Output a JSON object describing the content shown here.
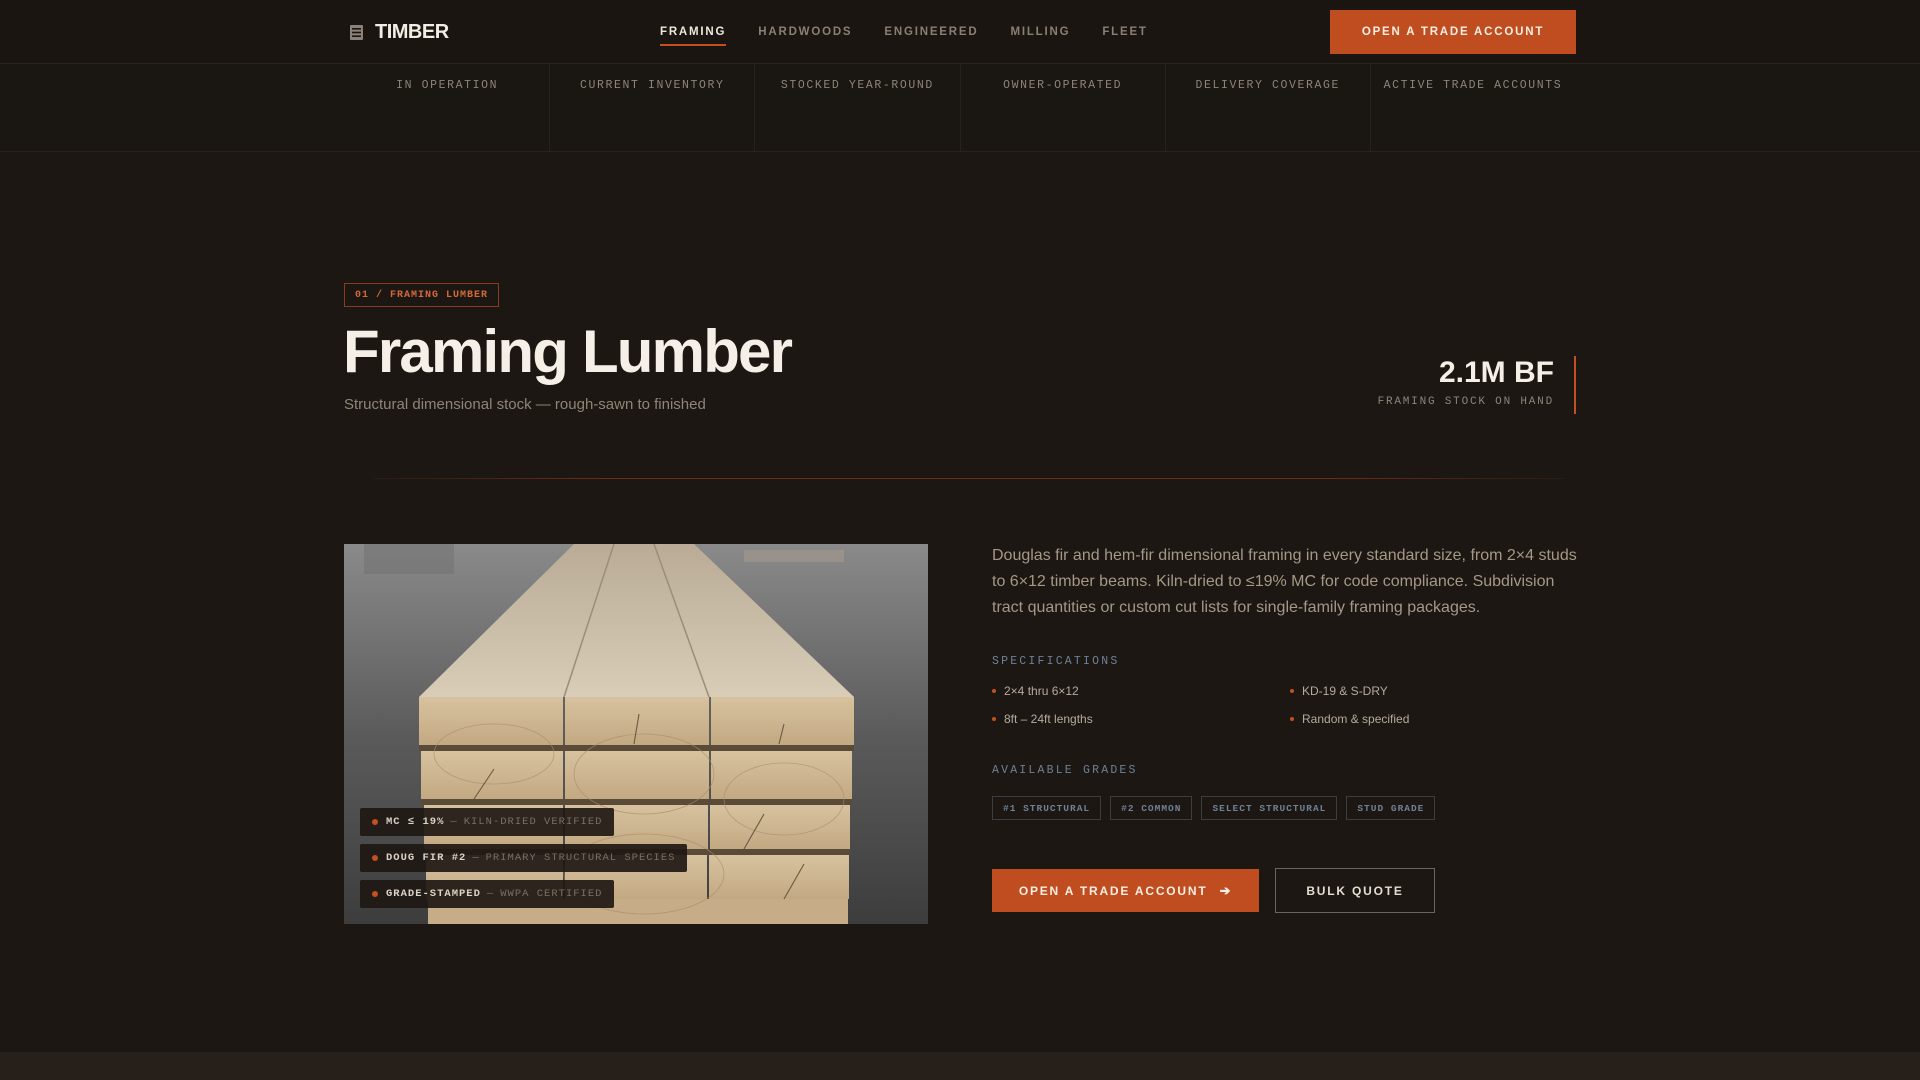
{
  "brand": {
    "name": "TIMBER",
    "icon": "lumber-stack-icon"
  },
  "nav": {
    "links": [
      {
        "label": "FRAMING",
        "active": true
      },
      {
        "label": "HARDWOODS",
        "active": false
      },
      {
        "label": "ENGINEERED",
        "active": false
      },
      {
        "label": "MILLING",
        "active": false
      },
      {
        "label": "FLEET",
        "active": false
      }
    ],
    "cta_label": "OPEN A TRADE ACCOUNT"
  },
  "stats": [
    {
      "label": "IN OPERATION"
    },
    {
      "label": "CURRENT INVENTORY"
    },
    {
      "label": "STOCKED YEAR-ROUND"
    },
    {
      "label": "OWNER-OPERATED"
    },
    {
      "label": "DELIVERY COVERAGE"
    },
    {
      "label": "ACTIVE TRADE ACCOUNTS"
    }
  ],
  "section": {
    "eyebrow": "01 / FRAMING LUMBER",
    "title": "Framing Lumber",
    "subtitle": "Structural dimensional stock — rough-sawn to finished",
    "metric_value": "2.1M BF",
    "metric_label": "FRAMING STOCK ON HAND"
  },
  "photo": {
    "badges": [
      {
        "key": "MC ≤ 19%",
        "desc": "KILN-DRIED VERIFIED"
      },
      {
        "key": "DOUG FIR #2",
        "desc": "PRIMARY STRUCTURAL SPECIES"
      },
      {
        "key": "GRADE-STAMPED",
        "desc": "WWPA CERTIFIED"
      }
    ],
    "separator": "—"
  },
  "details": {
    "description": "Douglas fir and hem-fir dimensional framing in every standard size, from 2×4 studs to 6×12 timber beams. Kiln-dried to ≤19% MC for code compliance. Subdivision tract quantities or custom cut lists for single-family framing packages.",
    "specs_label": "SPECIFICATIONS",
    "specs": [
      "2×4 thru 6×12",
      "KD-19 & S-DRY",
      "8ft – 24ft lengths",
      "Random & specified"
    ],
    "grades_label": "AVAILABLE GRADES",
    "grades": [
      "#1 STRUCTURAL",
      "#2 COMMON",
      "SELECT STRUCTURAL",
      "STUD GRADE"
    ],
    "primary_cta": "OPEN A TRADE ACCOUNT",
    "primary_cta_icon": "arrow-right-icon",
    "secondary_cta": "BULK QUOTE"
  },
  "colors": {
    "background": "#1c1713",
    "accent": "#bf4d1f",
    "text": "#f5efe7",
    "muted": "#8e8478",
    "spec_label": "#6d8197"
  }
}
